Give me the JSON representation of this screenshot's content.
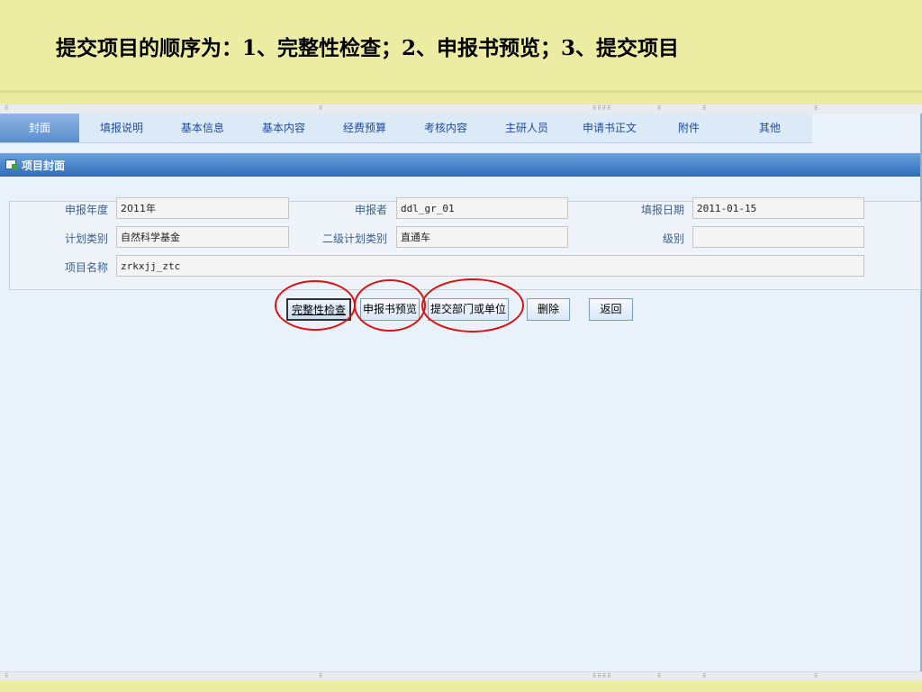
{
  "slide": {
    "title": "提交项目的顺序为：1、完整性检查；2、申报书预览；3、提交项目"
  },
  "tabs": [
    "封面",
    "填报说明",
    "基本信息",
    "基本内容",
    "经费预算",
    "考核内容",
    "主研人员",
    "申请书正文",
    "附件",
    "其他"
  ],
  "section": {
    "title": "项目封面",
    "icon": "form-icon"
  },
  "form": {
    "year_label": "申报年度",
    "year_value": "2011年",
    "applicant_label": "申报者",
    "applicant_value": "ddl_gr_01",
    "date_label": "填报日期",
    "date_value": "2011-01-15",
    "plan_label": "计划类别",
    "plan_value": "自然科学基金",
    "subplan_label": "二级计划类别",
    "subplan_value": "直通车",
    "level_label": "级别",
    "level_value": "",
    "name_label": "项目名称",
    "name_value": "zrkxjj_ztc"
  },
  "buttons": {
    "check": "完整性检查",
    "preview": "申报书预览",
    "submit": "提交部门或单位",
    "delete": "删除",
    "back": "返回"
  },
  "colors": {
    "annotation_ring": "#e01010",
    "section_bar": "#3a78c2",
    "slide_background": "#ececa2"
  }
}
